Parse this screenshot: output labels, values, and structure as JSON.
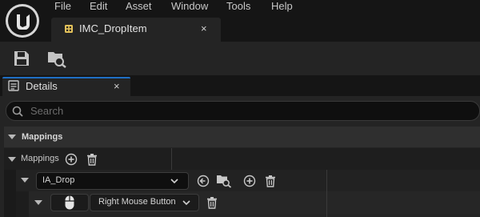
{
  "menu": {
    "items": [
      "File",
      "Edit",
      "Asset",
      "Window",
      "Tools",
      "Help"
    ]
  },
  "editor_tab": {
    "title": "IMC_DropItem",
    "close": "×"
  },
  "toolbar": {
    "save_icon": "save-icon",
    "browse_icon": "browse-to-asset-icon"
  },
  "details": {
    "title": "Details",
    "close": "×",
    "search": {
      "placeholder": "Search",
      "value": ""
    }
  },
  "mappings_section": {
    "header": "Mappings",
    "property_label": "Mappings"
  },
  "mapping_entry": {
    "input_action": "IA_Drop",
    "key_icon": "mouse-icon",
    "key": "Right Mouse Button"
  },
  "colors": {
    "accent": "#1f6fc4",
    "background": "#151515",
    "panel": "#242424"
  }
}
